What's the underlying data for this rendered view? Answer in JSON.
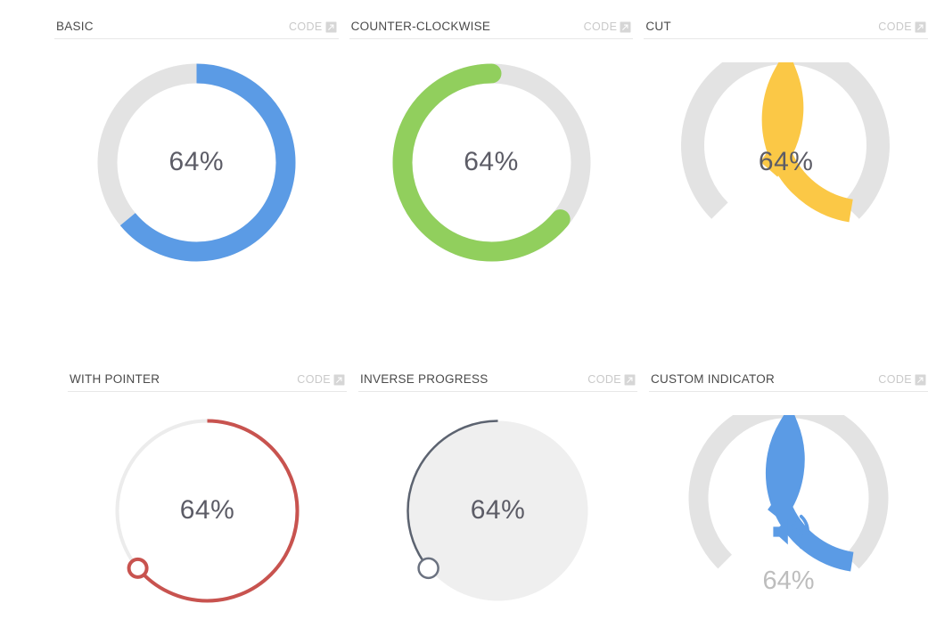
{
  "page": {
    "background": "#ffffff",
    "code_label": "CODE",
    "code_icon": "launch-external-icon"
  },
  "colors": {
    "blue": "#5b9be5",
    "green": "#91cf5d",
    "yellow": "#fbc846",
    "red": "#c8534f",
    "dark_grey": "#5c6370",
    "track_grey": "#e3e3e3",
    "track_light": "#ececec",
    "disc_fill": "#efefef",
    "value_text": "#5c5c66",
    "sub_text": "#bdbdbd",
    "title_text": "#4a4a4a",
    "link_text": "#c9c9c9",
    "divider": "#e8e8e8"
  },
  "cards": [
    {
      "id": "basic",
      "title": "BASIC",
      "code_label": "CODE",
      "value_text": "64%",
      "value": 64,
      "color": "#5b9be5",
      "track": "#e3e3e3"
    },
    {
      "id": "counter-clockwise",
      "title": "COUNTER-CLOCKWISE",
      "code_label": "CODE",
      "value_text": "64%",
      "value": 64,
      "color": "#91cf5d",
      "track": "#e3e3e3"
    },
    {
      "id": "cut",
      "title": "CUT",
      "code_label": "CODE",
      "value_text": "64%",
      "value": 64,
      "color": "#fbc846",
      "track": "#e3e3e3"
    },
    {
      "id": "with-pointer",
      "title": "WITH POINTER",
      "code_label": "CODE",
      "value_text": "64%",
      "value": 64,
      "color": "#c8534f",
      "track": "#ececec"
    },
    {
      "id": "inverse-progress",
      "title": "INVERSE PROGRESS",
      "code_label": "CODE",
      "value_text": "64%",
      "value": 64,
      "color": "#5c6370",
      "track": "#efefef"
    },
    {
      "id": "custom-indicator",
      "title": "CUSTOM INDICATOR",
      "code_label": "CODE",
      "value_text": "64%",
      "value": 64,
      "color": "#5b9be5",
      "track": "#e3e3e3",
      "indicator_icon": "volume-up-icon",
      "sub_value_text": "64%"
    }
  ]
}
